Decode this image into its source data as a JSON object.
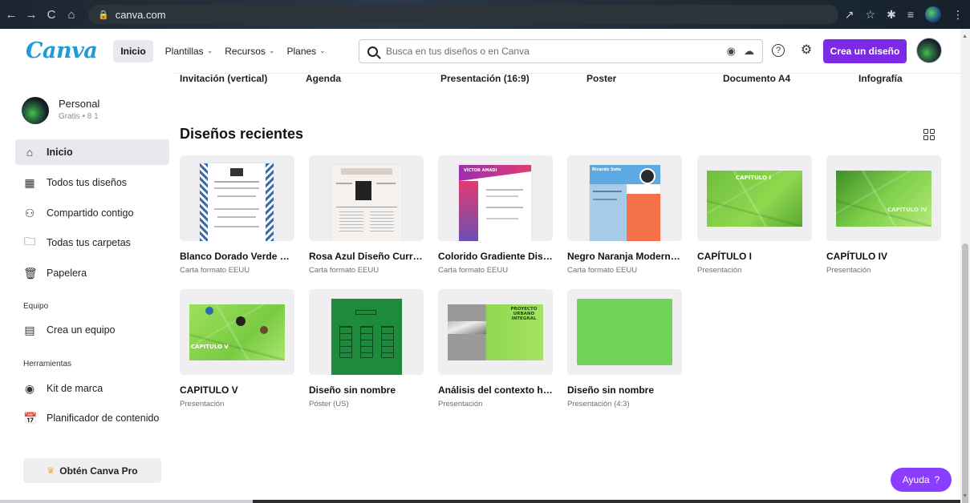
{
  "browser": {
    "url": "canva.com",
    "nav": [
      "←",
      "→",
      "C",
      "⌂"
    ]
  },
  "header": {
    "logo": "Canva",
    "nav_inicio": "Inicio",
    "nav_plantillas": "Plantillas",
    "nav_recursos": "Recursos",
    "nav_planes": "Planes",
    "search_placeholder": "Busca en tus diseños o en Canva",
    "create_button": "Crea un diseño"
  },
  "sidebar": {
    "profile_name": "Personal",
    "profile_sub": "Gratis • 8 1",
    "items": [
      {
        "label": "Inicio",
        "icon": "home-icon"
      },
      {
        "label": "Todos tus diseños",
        "icon": "grid-icon"
      },
      {
        "label": "Compartido contigo",
        "icon": "shared-icon"
      },
      {
        "label": "Todas tus carpetas",
        "icon": "folder-icon"
      },
      {
        "label": "Papelera",
        "icon": "trash-icon"
      }
    ],
    "section_equipo": "Equipo",
    "team_item": "Crea un equipo",
    "section_herramientas": "Herramientas",
    "tools": [
      {
        "label": "Kit de marca",
        "icon": "brand-kit-icon"
      },
      {
        "label": "Planificador de contenido",
        "icon": "calendar-icon"
      }
    ],
    "pro_button": "Obtén Canva Pro"
  },
  "template_types": [
    "Invitación (vertical)",
    "Agenda",
    "Presentación (16:9)",
    "Poster",
    "Documento A4",
    "Infografía"
  ],
  "main": {
    "section_title": "Diseños recientes"
  },
  "designs": [
    {
      "title": "Blanco Dorado Verde Ge...",
      "type": "Carta formato EEUU"
    },
    {
      "title": "Rosa Azul Diseño Currícu...",
      "type": "Carta formato EEUU"
    },
    {
      "title": "Colorido Gradiente Diseñ...",
      "type": "Carta formato EEUU"
    },
    {
      "title": "Negro Naranja Moderno ...",
      "type": "Carta formato EEUU"
    },
    {
      "title": "CAPÍTULO I",
      "type": "Presentación"
    },
    {
      "title": "CAPÍTULO IV",
      "type": "Presentación"
    },
    {
      "title": "CAPITULO V",
      "type": "Presentación"
    },
    {
      "title": "Diseño sin nombre",
      "type": "Póster (US)"
    },
    {
      "title": "Análisis del contexto hist...",
      "type": "Presentación"
    },
    {
      "title": "Diseño sin nombre",
      "type": "Presentación (4:3)"
    }
  ],
  "thumb_text": {
    "cap1": "CAPÍTULO I",
    "cap4": "CAPÍTULO IV",
    "cap5": "CAPITULO V",
    "proyecto": "PROYECTO URBANO INTEGRAL",
    "victor": "VÍCTOR AMADI",
    "ricardo": "Ricardo Soto"
  },
  "help_button": "Ayuda",
  "colors": {
    "accent": "#7d2ae8",
    "logo": "#1f9bd6",
    "help": "#8b3dff"
  }
}
